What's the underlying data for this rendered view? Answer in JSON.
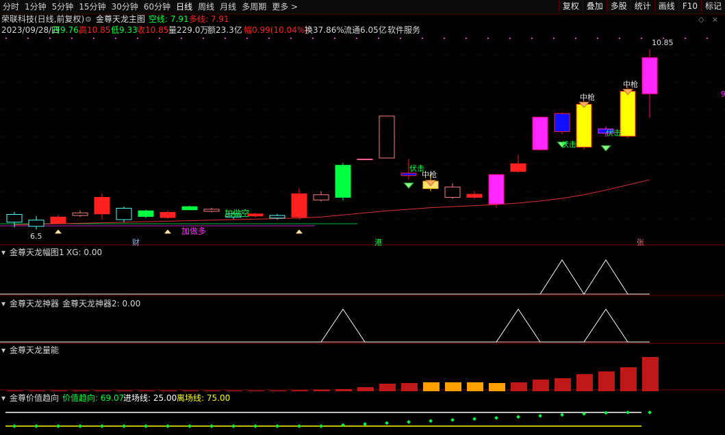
{
  "toolbar": {
    "periods": [
      "分时",
      "1分钟",
      "5分钟",
      "15分钟",
      "30分钟",
      "60分钟",
      "日线",
      "周线",
      "月线",
      "多周期",
      "更多 >"
    ],
    "active_period": "日线",
    "right_buttons": [
      "复权",
      "叠加",
      "多股",
      "统计",
      "画线",
      "F10",
      "标记"
    ]
  },
  "header": {
    "stock": "荣联科技(日线,前复权)",
    "indicator_name": "金尊天龙主图",
    "short_line_label": "空线: 7.91",
    "long_line_label": "多线: 7.91",
    "date": "2023/09/28/四",
    "open": "开9.76",
    "high": "高10.85",
    "low": "低9.33",
    "close": "收10.85",
    "volume": "量229.0万",
    "amount": "额23.3亿",
    "change": "幅0.99(10.04%)",
    "turnover": "换37.86%",
    "float": "流通6.05亿",
    "sector": "软件服务"
  },
  "annotations": {
    "high_price": "10.85",
    "low_price": "6.5",
    "zhongqiang": "中枪",
    "fuji": "伏击",
    "add_short": "加做空",
    "add_long": "加做多",
    "news_cai": "财",
    "news_gang": "港",
    "news_zhang": "张",
    "axis_hint": "9"
  },
  "panels": {
    "p1": {
      "title": "金尊天龙幅图1",
      "value": "XG: 0.00"
    },
    "p2": {
      "title": "金尊天龙神器",
      "value": "金尊天龙神器2: 0.00"
    },
    "p3": {
      "title": "金尊天龙量能"
    },
    "p4": {
      "title": "金尊价值趋向",
      "v1": "价值趋向: 69.07",
      "v2": "进场线: 25.00",
      "v3": "离场线: 75.00"
    }
  },
  "colors": {
    "up": "#ff2020",
    "down": "#00ff40",
    "cyan": "#54ffff",
    "magenta": "#ff29ff",
    "yellow": "#ffff00",
    "blue": "#1010ff",
    "grid": "#550000",
    "ma": "#e03030"
  },
  "chart_data": {
    "type": "candlestick",
    "candles": [
      {
        "o": 7.65,
        "h": 7.7,
        "l": 7.4,
        "c": 7.5,
        "style": "hollow-cyan"
      },
      {
        "o": 7.42,
        "h": 7.62,
        "l": 7.36,
        "c": 7.54,
        "style": "hollow-cyan"
      },
      {
        "o": 7.6,
        "h": 7.64,
        "l": 7.46,
        "c": 7.48,
        "style": "red"
      },
      {
        "o": 7.68,
        "h": 7.73,
        "l": 7.6,
        "c": 7.63,
        "style": "hollow-red"
      },
      {
        "o": 7.98,
        "h": 8.06,
        "l": 7.55,
        "c": 7.66,
        "style": "red"
      },
      {
        "o": 7.77,
        "h": 7.8,
        "l": 7.5,
        "c": 7.55,
        "style": "hollow-cyan"
      },
      {
        "o": 7.72,
        "h": 7.74,
        "l": 7.58,
        "c": 7.61,
        "style": "green"
      },
      {
        "o": 7.69,
        "h": 7.72,
        "l": 7.57,
        "c": 7.59,
        "style": "red"
      },
      {
        "o": 7.8,
        "h": 7.82,
        "l": 7.73,
        "c": 7.74,
        "style": "green"
      },
      {
        "o": 7.75,
        "h": 7.78,
        "l": 7.69,
        "c": 7.71,
        "style": "hollow-red"
      },
      {
        "o": 7.66,
        "h": 7.7,
        "l": 7.56,
        "c": 7.6,
        "style": "hollow-cyan"
      },
      {
        "o": 7.66,
        "h": 7.68,
        "l": 7.59,
        "c": 7.62,
        "style": "red"
      },
      {
        "o": 7.63,
        "h": 7.66,
        "l": 7.55,
        "c": 7.58,
        "style": "hollow-cyan"
      },
      {
        "o": 8.05,
        "h": 8.15,
        "l": 7.55,
        "c": 7.6,
        "style": "red"
      },
      {
        "o": 7.93,
        "h": 8.1,
        "l": 7.9,
        "c": 8.03,
        "style": "hollow-red"
      },
      {
        "o": 8.6,
        "h": 8.65,
        "l": 7.92,
        "c": 7.98,
        "style": "green"
      },
      {
        "o": 8.72,
        "h": 8.72,
        "l": 8.72,
        "c": 8.72,
        "style": "doji"
      },
      {
        "o": 9.55,
        "h": 9.55,
        "l": 8.74,
        "c": 8.74,
        "style": "hollow-red"
      },
      {
        "o": 8.45,
        "h": 8.72,
        "l": 8.32,
        "c": 8.4,
        "style": "blue-red"
      },
      {
        "o": 8.29,
        "h": 8.42,
        "l": 8.1,
        "c": 8.15,
        "style": "yellow-hollow"
      },
      {
        "o": 8.18,
        "h": 8.25,
        "l": 7.95,
        "c": 7.98,
        "style": "hollow-red"
      },
      {
        "o": 8.04,
        "h": 8.1,
        "l": 7.95,
        "c": 7.98,
        "style": "red"
      },
      {
        "o": 8.42,
        "h": 8.42,
        "l": 7.78,
        "c": 7.85,
        "style": "magenta"
      },
      {
        "o": 8.63,
        "h": 8.8,
        "l": 8.46,
        "c": 8.48,
        "style": "red"
      },
      {
        "o": 9.53,
        "h": 9.53,
        "l": 8.88,
        "c": 8.9,
        "style": "magenta"
      },
      {
        "o": 9.6,
        "h": 9.62,
        "l": 9.2,
        "c": 9.25,
        "style": "blue"
      },
      {
        "o": 9.78,
        "h": 9.85,
        "l": 8.9,
        "c": 8.95,
        "style": "yellow"
      },
      {
        "o": 9.3,
        "h": 9.35,
        "l": 9.15,
        "c": 9.22,
        "style": "blue-magenta"
      },
      {
        "o": 10.03,
        "h": 10.12,
        "l": 9.12,
        "c": 9.16,
        "style": "yellow"
      },
      {
        "o": 10.68,
        "h": 10.85,
        "l": 9.52,
        "c": 9.98,
        "style": "magenta"
      }
    ],
    "ma_line": [
      7.45,
      7.46,
      7.47,
      7.48,
      7.49,
      7.5,
      7.51,
      7.52,
      7.53,
      7.54,
      7.55,
      7.56,
      7.57,
      7.58,
      7.6,
      7.64,
      7.68,
      7.72,
      7.75,
      7.78,
      7.8,
      7.82,
      7.84,
      7.87,
      7.91,
      7.96,
      8.03,
      8.12,
      8.22,
      8.32
    ],
    "y_range": [
      7.3,
      11.0
    ],
    "xg_signal": [
      0,
      0,
      0,
      0,
      0,
      0,
      0,
      0,
      0,
      0,
      0,
      0,
      0,
      0,
      0,
      0,
      0,
      0,
      0,
      0,
      0,
      0,
      0,
      0,
      0,
      1,
      0,
      1,
      0,
      0
    ],
    "shenqi_signal": [
      0,
      0,
      0,
      0,
      0,
      0,
      0,
      0,
      0,
      0,
      0,
      0,
      0,
      0,
      0,
      1,
      0,
      0,
      0,
      0,
      0,
      0,
      0,
      1,
      0,
      0,
      0,
      1,
      0,
      0
    ],
    "volume": [
      0.8,
      0.8,
      0.8,
      0.8,
      0.8,
      0.8,
      0.8,
      0.8,
      0.8,
      0.8,
      0.8,
      0.8,
      0.9,
      1.5,
      2.5,
      3.2,
      6,
      11,
      12,
      13,
      13,
      13,
      12,
      13,
      17,
      19,
      25,
      29,
      35,
      50
    ],
    "volume_style": [
      "r",
      "r",
      "r",
      "r",
      "r",
      "r",
      "r",
      "r",
      "r",
      "r",
      "r",
      "r",
      "r",
      "r",
      "r",
      "r",
      "r",
      "r",
      "r",
      "o",
      "o",
      "o",
      "o",
      "r",
      "r",
      "r",
      "r",
      "r",
      "r",
      "r"
    ],
    "value_trend": [
      69.07
    ]
  }
}
